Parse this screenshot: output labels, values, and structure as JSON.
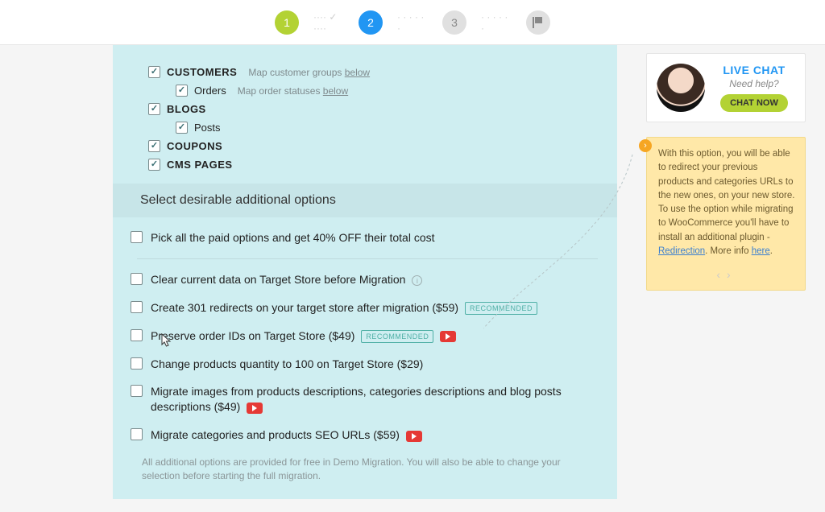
{
  "steps": {
    "s1": "1",
    "s2": "2",
    "s3": "3"
  },
  "entities": {
    "customers": "CUSTOMERS",
    "customers_hint_prefix": "Map customer groups ",
    "customers_hint_link": "below",
    "orders": "Orders",
    "orders_hint_prefix": "Map order statuses ",
    "orders_hint_link": "below",
    "blogs": "BLOGS",
    "posts": "Posts",
    "coupons": "COUPONS",
    "cms": "CMS PAGES"
  },
  "section_title": "Select desirable additional options",
  "options": {
    "pickall": "Pick all the paid options and get 40% OFF their total cost",
    "clear": "Clear current data on Target Store before Migration",
    "redirects": "Create 301 redirects on your target store after migration ($59)",
    "orderids": "Preserve order IDs on Target Store ($49)",
    "qty": "Change products quantity to 100 on Target Store ($29)",
    "images": "Migrate images from products descriptions, categories descriptions and blog posts descriptions ($49)",
    "seourls": "Migrate categories and products SEO URLs ($59)"
  },
  "badge_recommended": "RECOMMENDED",
  "footnote": "All additional options are provided for free in Demo Migration. You will also be able to change your selection before starting the full migration.",
  "chat": {
    "title": "LIVE CHAT",
    "sub": "Need help?",
    "btn": "CHAT NOW"
  },
  "tip": {
    "t1": "With this option, you will be able to redirect your previous products and categories URLs to the new ones, on your new store. To use the option while migrating to WooCommerce you'll have to install an additional plugin - ",
    "link1": "Redirection",
    "t2": ". More info ",
    "link2": "here",
    "t3": "."
  }
}
